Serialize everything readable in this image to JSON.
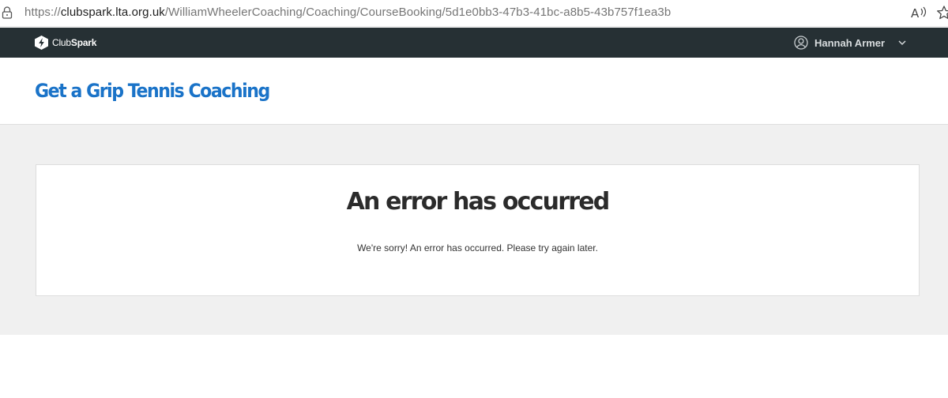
{
  "browser": {
    "url_prefix": "https://",
    "url_host": "clubspark.lta.org.uk",
    "url_path": "/WilliamWheelerCoaching/Coaching/CourseBooking/5d1e0bb3-47b3-41bc-a8b5-43b757f1ea3b",
    "icons": [
      "lock-icon",
      "read-aloud-icon",
      "star-icon"
    ]
  },
  "navbar": {
    "logo_light": "Club",
    "logo_bold": "Spark",
    "user_name": "Hannah Armer",
    "background": "#263034"
  },
  "venue": {
    "title": "Get a Grip Tennis Coaching",
    "title_color": "#1a73c8"
  },
  "error": {
    "title": "An error has occurred",
    "message": "We're sorry! An error has occurred. Please try again later."
  }
}
